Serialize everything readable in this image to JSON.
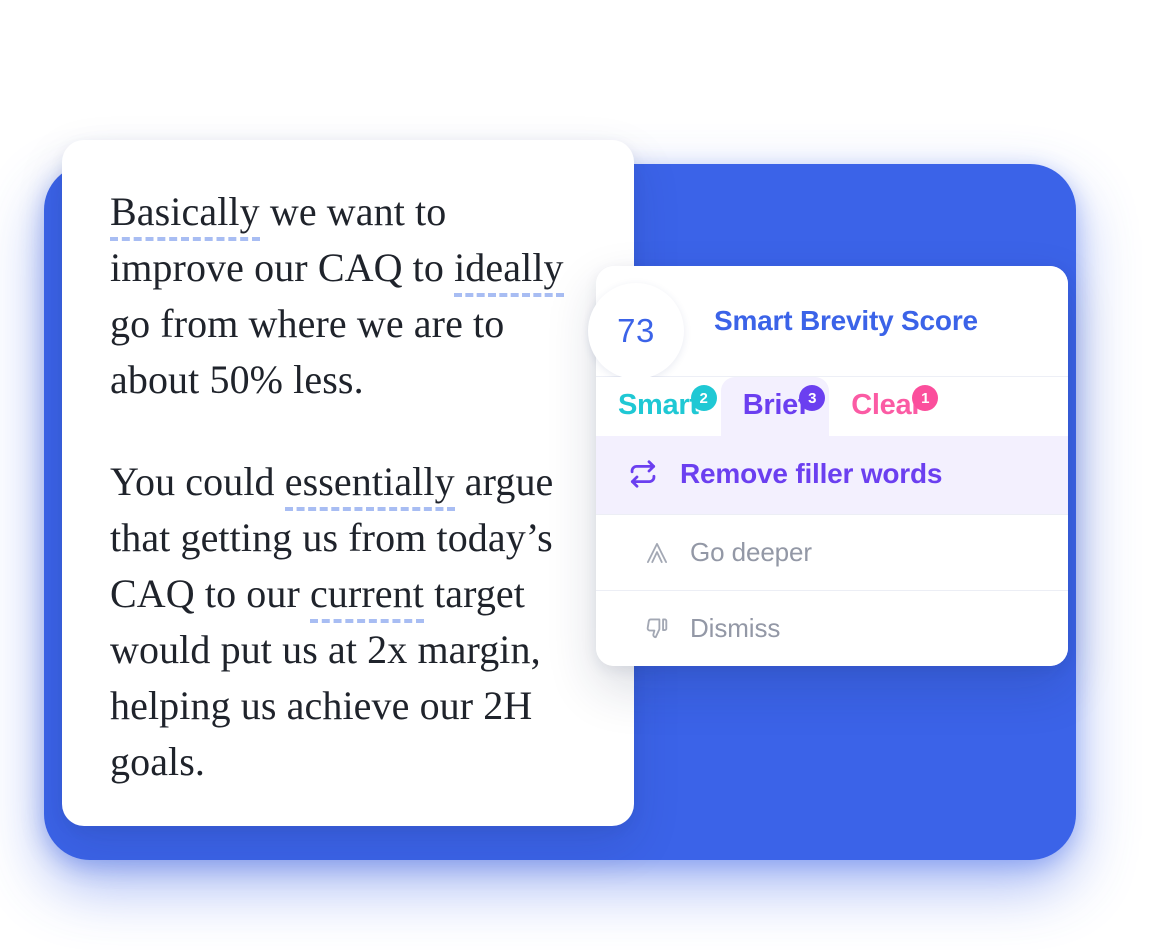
{
  "document": {
    "paragraphs": [
      {
        "segments": [
          {
            "text": "Basically",
            "flagged": true
          },
          {
            "text": " we want to improve our CAQ to ",
            "flagged": false
          },
          {
            "text": "ideally",
            "flagged": true
          },
          {
            "text": " go from where we are to about 50% less.",
            "flagged": false
          }
        ]
      },
      {
        "segments": [
          {
            "text": "You could ",
            "flagged": false
          },
          {
            "text": "essentially",
            "flagged": true
          },
          {
            "text": " argue that getting us from today’s CAQ to our ",
            "flagged": false
          },
          {
            "text": "current",
            "flagged": true
          },
          {
            "text": " target would put us at 2x margin, helping us achieve our 2H goals.",
            "flagged": false
          }
        ]
      }
    ]
  },
  "panel": {
    "score": {
      "value": "73",
      "percent": 73,
      "title": "Smart Brevity Score",
      "color": "#3B63E8"
    },
    "tabs": [
      {
        "label": "Smart",
        "badge": "2",
        "active": false,
        "color": "#1FC8D4",
        "icon": "smart-tab"
      },
      {
        "label": "Brief",
        "badge": "3",
        "active": true,
        "color": "#6B3FF0",
        "icon": "brief-tab"
      },
      {
        "label": "Clear",
        "badge": "1",
        "active": false,
        "color": "#FB5BA4",
        "icon": "clear-tab"
      }
    ],
    "primary_suggestion": {
      "label": "Remove filler words",
      "icon": "swap-arrows-icon",
      "color": "#6B3FF0",
      "background": "#F3F0FE"
    },
    "actions": [
      {
        "label": "Go deeper",
        "icon": "axios-a-icon"
      },
      {
        "label": "Dismiss",
        "icon": "thumbs-down-icon"
      }
    ]
  },
  "theme": {
    "plate_blue": "#3B63E8",
    "card_white": "#FFFFFF",
    "flag_underline": "#A8BDF3",
    "muted_text": "#9398A6",
    "doc_text": "#1F232B"
  }
}
